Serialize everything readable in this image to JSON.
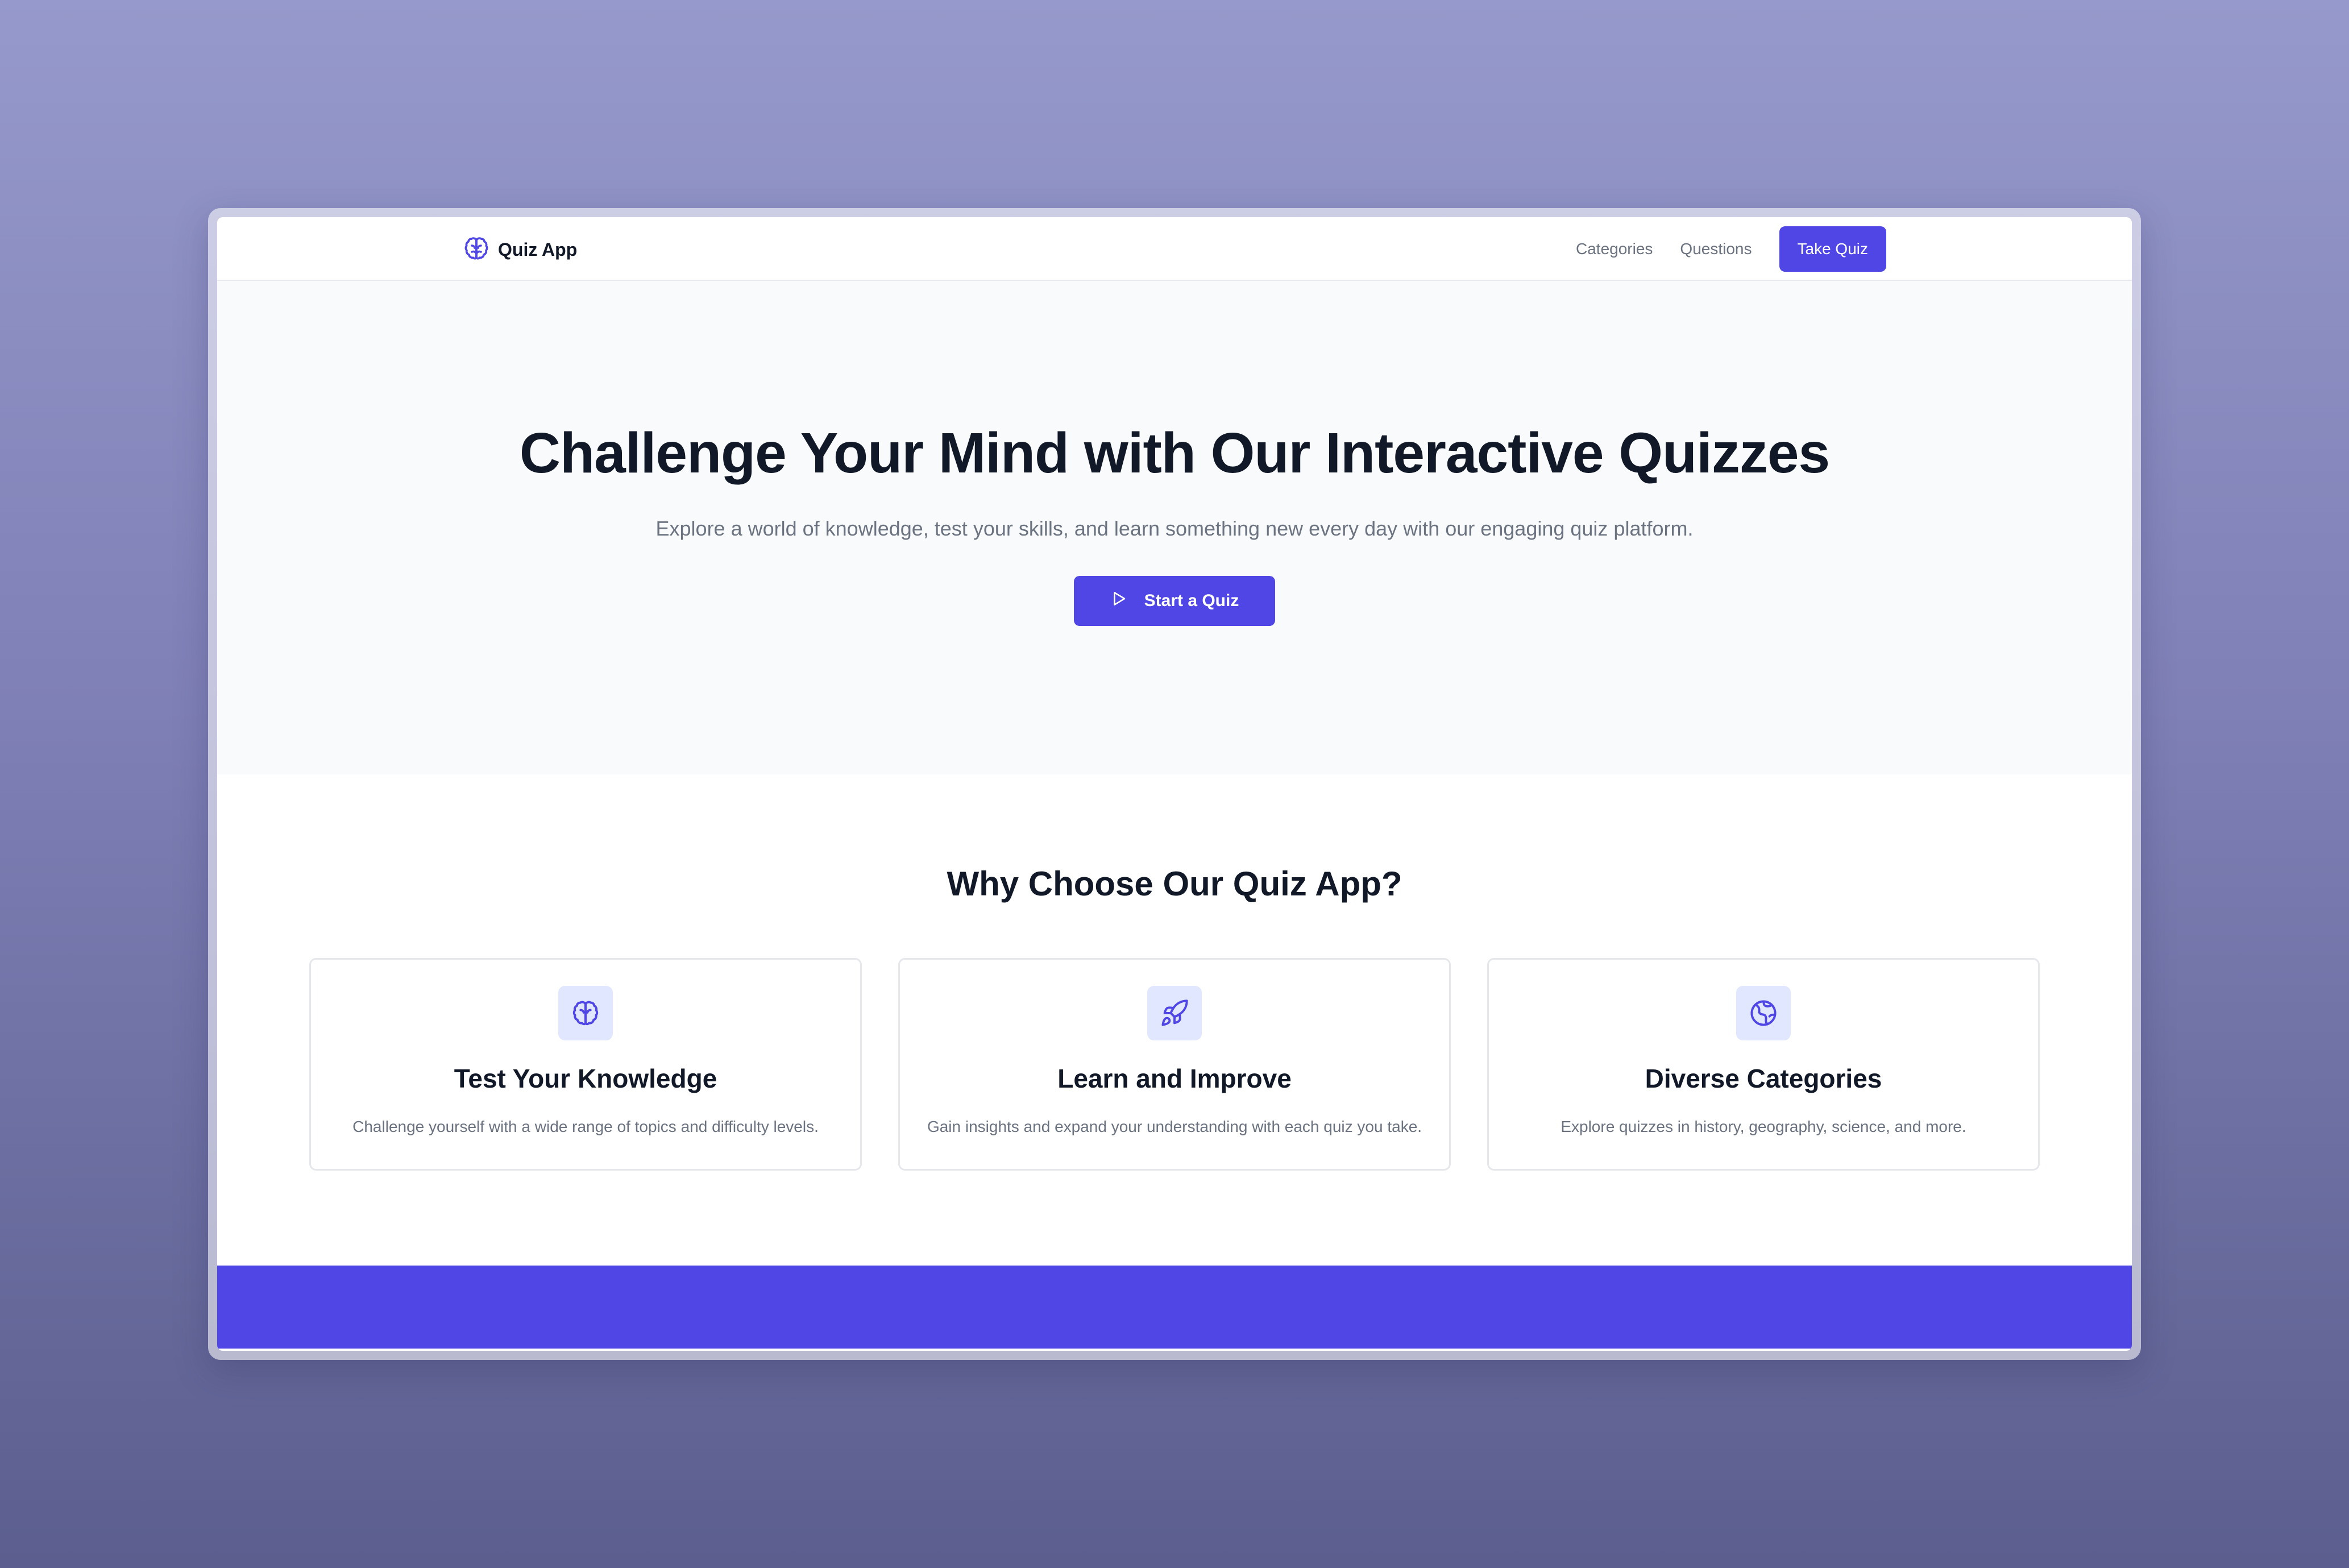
{
  "colors": {
    "accent": "#4f46e5",
    "accent_light": "#e0e7ff",
    "heading": "#111827",
    "muted": "#6b7280",
    "hero_bg": "#f9fafb"
  },
  "nav": {
    "brand_icon": "brain-icon",
    "brand_name": "Quiz App",
    "links": [
      "Categories",
      "Questions"
    ],
    "cta_label": "Take Quiz"
  },
  "hero": {
    "title": "Challenge Your Mind with Our Interactive Quizzes",
    "subtitle": "Explore a world of knowledge, test your skills, and learn something new every day with our engaging quiz platform.",
    "button_icon": "play-icon",
    "button_label": "Start a Quiz"
  },
  "features": {
    "title": "Why Choose Our Quiz App?",
    "cards": [
      {
        "icon": "brain-icon",
        "title": "Test Your Knowledge",
        "description": "Challenge yourself with a wide range of topics and difficulty levels."
      },
      {
        "icon": "rocket-icon",
        "title": "Learn and Improve",
        "description": "Gain insights and expand your understanding with each quiz you take."
      },
      {
        "icon": "globe-icon",
        "title": "Diverse Categories",
        "description": "Explore quizzes in history, geography, science, and more."
      }
    ]
  }
}
